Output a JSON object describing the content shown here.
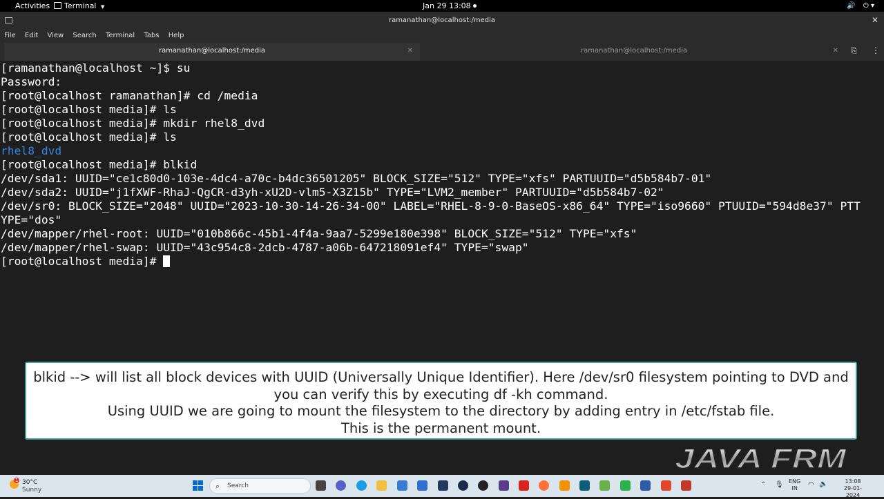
{
  "topbar": {
    "activities": "Activities",
    "app_menu": "Terminal",
    "clock": "Jan 29  13:08"
  },
  "window": {
    "title": "ramanathan@localhost:/media"
  },
  "menubar": {
    "items": [
      "File",
      "Edit",
      "View",
      "Search",
      "Terminal",
      "Tabs",
      "Help"
    ]
  },
  "tabs": [
    {
      "label": "ramanathan@localhost:/media",
      "active": true
    },
    {
      "label": "ramanathan@localhost:/media",
      "active": false
    }
  ],
  "terminal": {
    "lines": [
      "[ramanathan@localhost ~]$ su",
      "Password:",
      "[root@localhost ramanathan]# cd /media",
      "[root@localhost media]# ls",
      "[root@localhost media]# mkdir rhel8_dvd",
      "[root@localhost media]# ls",
      "rhel8_dvd",
      "[root@localhost media]# blkid",
      "/dev/sda1: UUID=\"ce1c80d0-103e-4dc4-a70c-b4dc36501205\" BLOCK_SIZE=\"512\" TYPE=\"xfs\" PARTUUID=\"d5b584b7-01\"",
      "/dev/sda2: UUID=\"j1fXWF-RhaJ-QgCR-d3yh-xU2D-vlm5-X3Z15b\" TYPE=\"LVM2_member\" PARTUUID=\"d5b584b7-02\"",
      "/dev/sr0: BLOCK_SIZE=\"2048\" UUID=\"2023-10-30-14-26-34-00\" LABEL=\"RHEL-8-9-0-BaseOS-x86_64\" TYPE=\"iso9660\" PTUUID=\"594d8e37\" PTT",
      "YPE=\"dos\"",
      "/dev/mapper/rhel-root: UUID=\"010b866c-45b1-4f4a-9aa7-5299e180e398\" BLOCK_SIZE=\"512\" TYPE=\"xfs\"",
      "/dev/mapper/rhel-swap: UUID=\"43c954c8-2dcb-4787-a06b-647218091ef4\" TYPE=\"swap\"",
      "[root@localhost media]# "
    ],
    "dir_color": "#3584e4",
    "text_color": "#ffffff",
    "background": "#1e1e1e"
  },
  "caption": {
    "lines": [
      "blkid --> will list all block devices with UUID (Universally Unique Identifier). Here /dev/sr0 filesystem pointing to DVD and",
      "you can verify this by executing df -kh command.",
      "Using UUID we are going to mount the filesystem to the directory by adding entry in /etc/fstab file.",
      "This is the permanent mount."
    ]
  },
  "watermark": {
    "text": "JAVA FRM"
  },
  "taskbar": {
    "weather_temp": "30°C",
    "weather_desc": "Sunny",
    "search_placeholder": "Search",
    "lang_top": "ENG",
    "lang_bottom": "IN",
    "time": "13:08",
    "date": "29-01-2024",
    "weather_badge": "1"
  },
  "icons": {
    "sound": "volume-icon",
    "power": "power-icon",
    "close": "close-icon"
  }
}
